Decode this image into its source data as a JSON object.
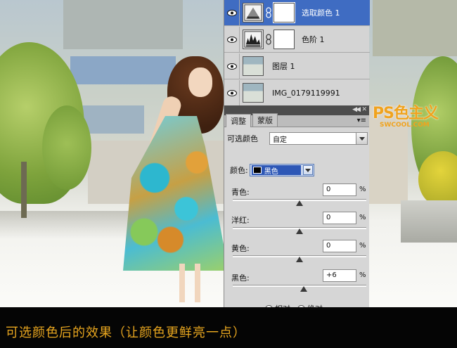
{
  "layers": [
    {
      "name": "选取颜色 1",
      "type": "adjustment-selective-color",
      "selected": true
    },
    {
      "name": "色阶 1",
      "type": "adjustment-levels",
      "selected": false
    },
    {
      "name": "图层 1",
      "type": "pixel",
      "selected": false
    },
    {
      "name": "IMG_0179119991",
      "type": "pixel",
      "selected": false
    }
  ],
  "adjustments_panel": {
    "tabs": [
      "调整",
      "蒙版"
    ],
    "active_tab": "调整",
    "preset_label": "可选颜色",
    "preset_value": "自定",
    "color_label": "颜色:",
    "color_value": "黑色",
    "color_swatch": "#000000",
    "sliders": [
      {
        "label": "青色:",
        "value": "0",
        "unit": "%",
        "level": 0
      },
      {
        "label": "洋红:",
        "value": "0",
        "unit": "%",
        "level": 0
      },
      {
        "label": "黄色:",
        "value": "0",
        "unit": "%",
        "level": 0
      },
      {
        "label": "黑色:",
        "value": "+6",
        "unit": "%",
        "level": 6
      }
    ],
    "method_options": [
      "相对",
      "绝对"
    ],
    "method_selected": "相对"
  },
  "watermark": {
    "cn": "PS色主义",
    "en": "SWCOOL.COM"
  },
  "caption": "可选颜色后的效果（让颜色更鲜亮一点）",
  "colors": {
    "accent_orange": "#e8a61f",
    "selection_blue": "#3f6cc2"
  }
}
